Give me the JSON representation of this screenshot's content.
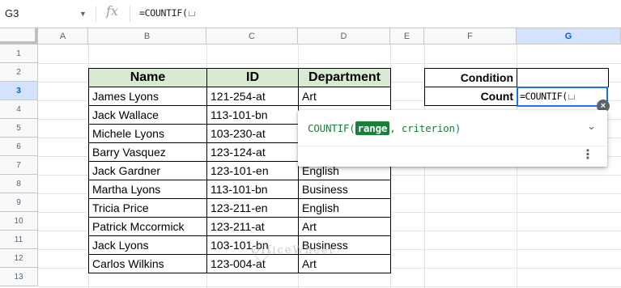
{
  "formula_bar": {
    "cell_ref": "G3",
    "fx_label": "fx",
    "formula": "=COUNTIF("
  },
  "columns": [
    "A",
    "B",
    "C",
    "D",
    "E",
    "F",
    "G"
  ],
  "rows": [
    "1",
    "2",
    "3",
    "4",
    "5",
    "6",
    "7",
    "8",
    "9",
    "10",
    "11",
    "12",
    "13"
  ],
  "table": {
    "headers": [
      "Name",
      "ID",
      "Department"
    ],
    "rows": [
      [
        "James Lyons",
        "121-254-at",
        "Art"
      ],
      [
        "Jack Wallace",
        "113-101-bn",
        ""
      ],
      [
        "Michele Lyons",
        "103-230-at",
        ""
      ],
      [
        "Barry Vasquez",
        "123-124-at",
        ""
      ],
      [
        "Jack Gardner",
        "123-101-en",
        "English"
      ],
      [
        "Martha Lyons",
        "113-101-bn",
        "Business"
      ],
      [
        "Tricia Price",
        "123-211-en",
        "English"
      ],
      [
        "Patrick Mccormick",
        "123-211-at",
        "Art"
      ],
      [
        "Jack Lyons",
        "103-101-bn",
        "Business"
      ],
      [
        "Carlos Wilkins",
        "123-004-at",
        "Art"
      ]
    ]
  },
  "side_table": {
    "condition_label": "Condition",
    "count_label": "Count",
    "active_value": "=COUNTIF("
  },
  "popup": {
    "func": "COUNTIF(",
    "arg_active": "range",
    "arg_rest": ", criterion)",
    "chevron": "⌄",
    "more": "⋮"
  },
  "watermark": "OfficeWheel",
  "colors": {
    "accent": "#1a73e8",
    "header_fill": "#d9ead3",
    "formula_green": "#188038"
  }
}
